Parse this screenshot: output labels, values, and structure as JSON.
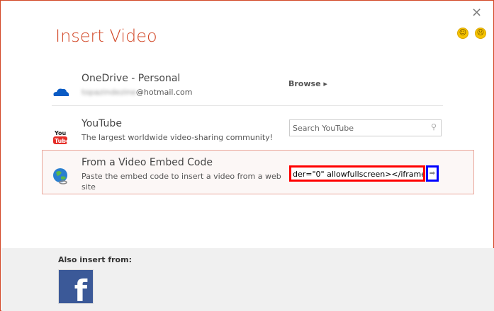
{
  "dialog": {
    "title": "Insert Video",
    "close_icon": "×",
    "smile_icon": "☺",
    "frown_icon": "☹",
    "border_color": "#d24726"
  },
  "sources": [
    {
      "title": "OneDrive - Personal",
      "subtitle": "@hotmail.com",
      "action": "Browse ▸",
      "icon": "cloud-icon"
    },
    {
      "title": "YouTube",
      "subtitle": "The largest worldwide video-sharing community!",
      "search_placeholder": "Search YouTube",
      "icon": "youtube-icon"
    },
    {
      "title": "From a Video Embed Code",
      "subtitle": "Paste the embed code to insert a video from a web site",
      "embed_value": "der=\"0\" allowfullscreen></iframe>",
      "icon": "globe-icon"
    }
  ],
  "footer": {
    "label": "Also insert from:",
    "facebook": "f"
  }
}
